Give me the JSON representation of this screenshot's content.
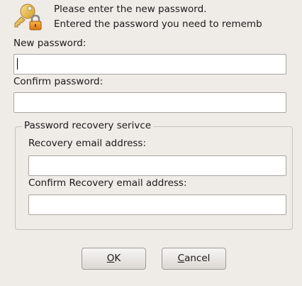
{
  "header": {
    "icon": "key-lock-icon",
    "line1": "Please enter the new password.",
    "line2": "Entered the password you need to rememb"
  },
  "new_password": {
    "label": "New password:",
    "value": ""
  },
  "confirm_password": {
    "label": "Confirm password:",
    "value": ""
  },
  "recovery": {
    "group_title": "Password recovery serivce",
    "email_label": "Recovery email address:",
    "email_value": "",
    "confirm_email_label": "Confirm Recovery email address:",
    "confirm_email_value": ""
  },
  "buttons": {
    "ok": {
      "mnemonic": "O",
      "rest": "K"
    },
    "cancel": {
      "mnemonic": "C",
      "rest": "ancel"
    }
  },
  "colors": {
    "background": "#efebe7",
    "key_gold": "#e8b94a",
    "lock_orange": "#e58a1f"
  }
}
